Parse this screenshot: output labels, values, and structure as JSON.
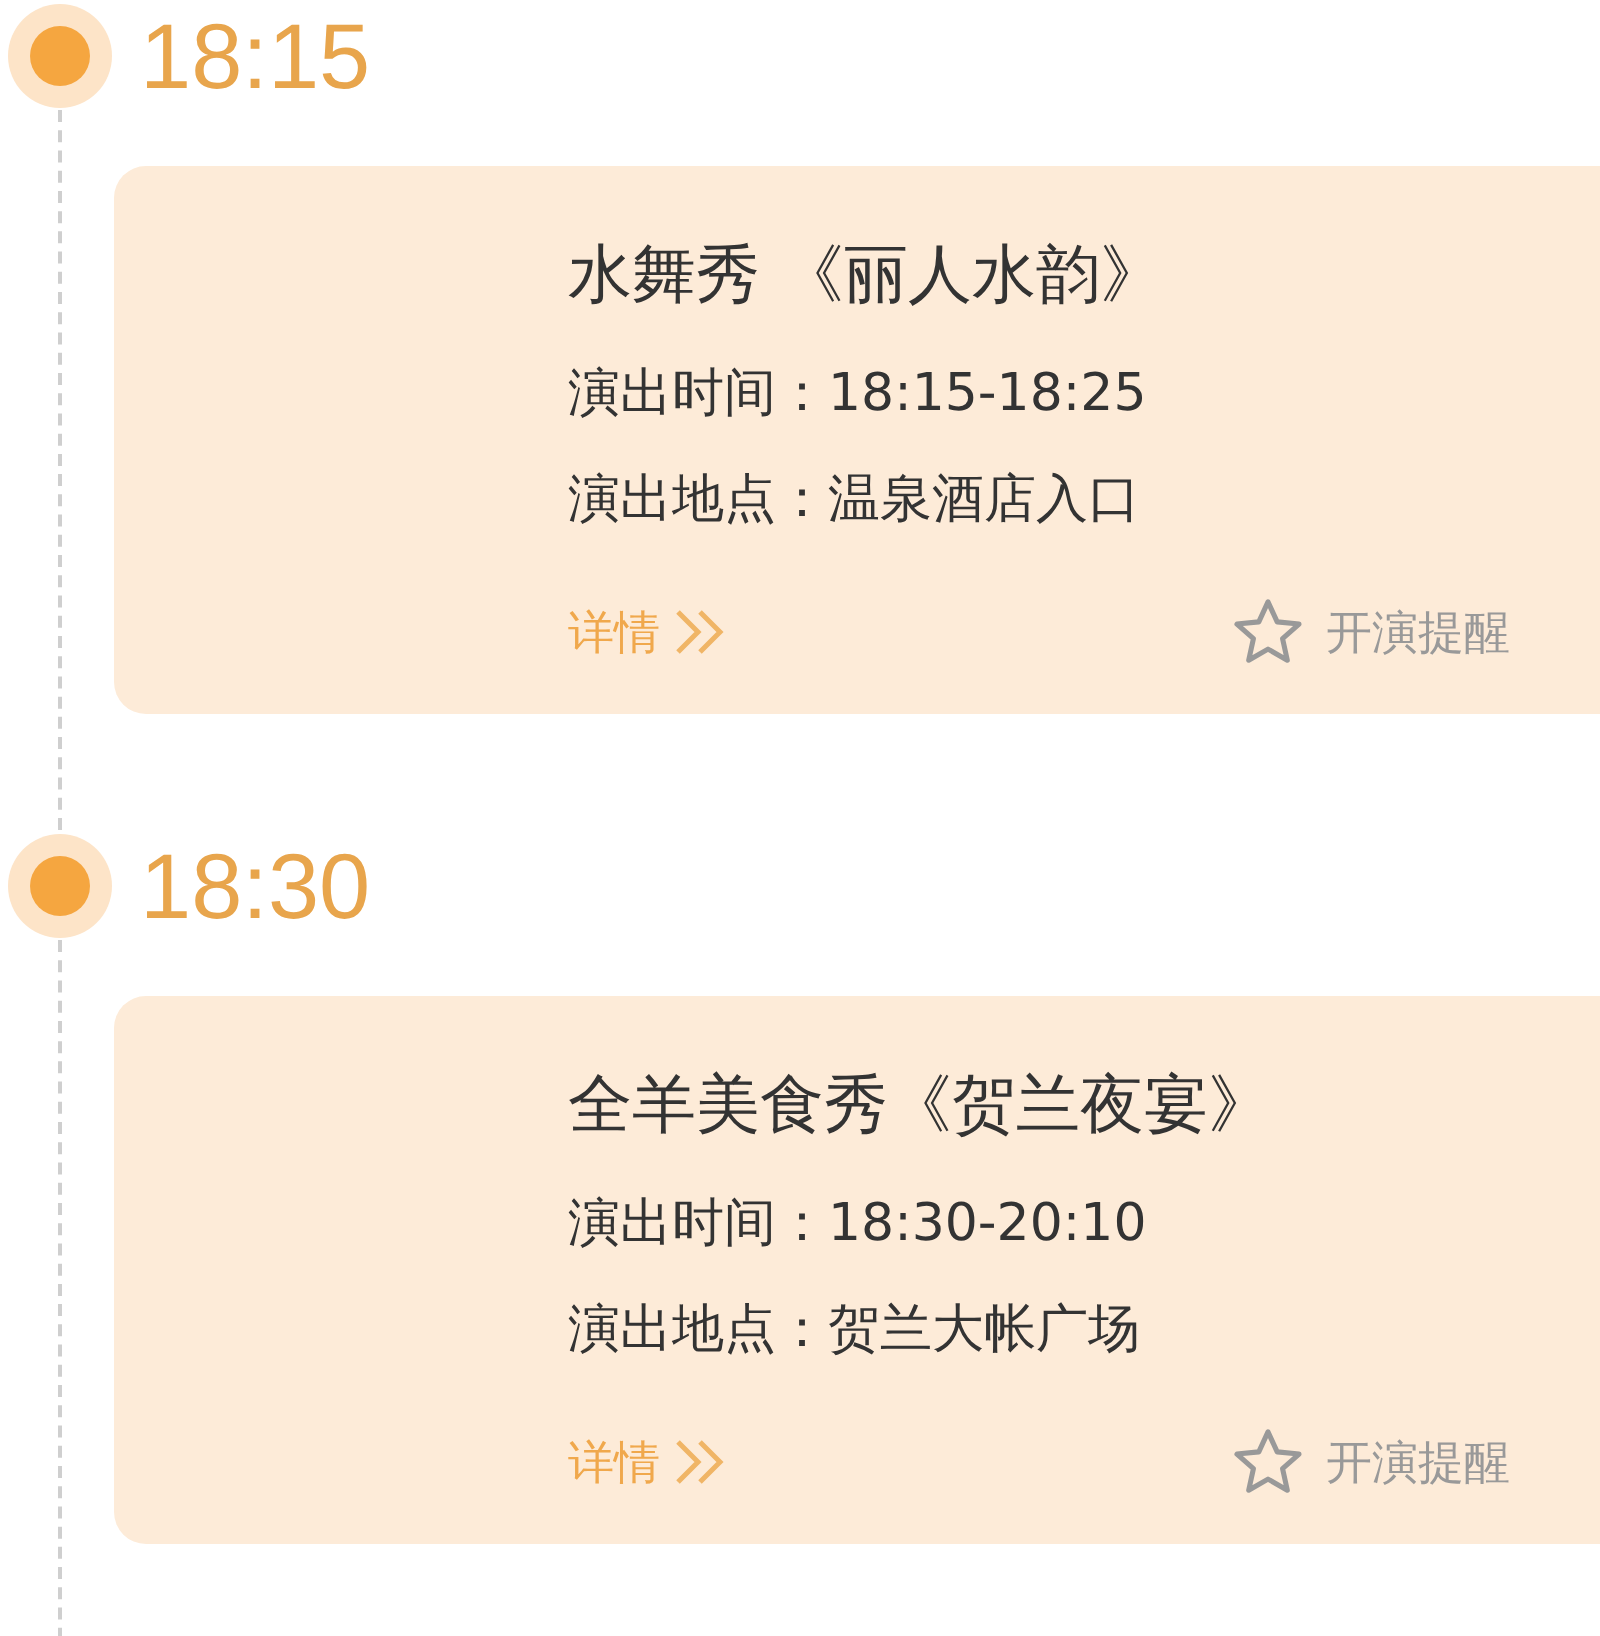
{
  "events": [
    {
      "time": "18:15",
      "title": "水舞秀 《丽人水韵》",
      "lines": [
        "演出时间：18:15-18:25",
        "演出地点：温泉酒店入口"
      ],
      "detail_link": "详情",
      "reminder": {
        "label": "开演提醒",
        "set": false
      }
    },
    {
      "time": "18:30",
      "title": "全羊美食秀《贺兰夜宴》",
      "lines": [
        "演出时间：18:30-20:10",
        "演出地点：贺兰大帐广场"
      ],
      "detail_link": "详情",
      "reminder": {
        "label": "开演提醒",
        "set": false
      }
    }
  ]
}
